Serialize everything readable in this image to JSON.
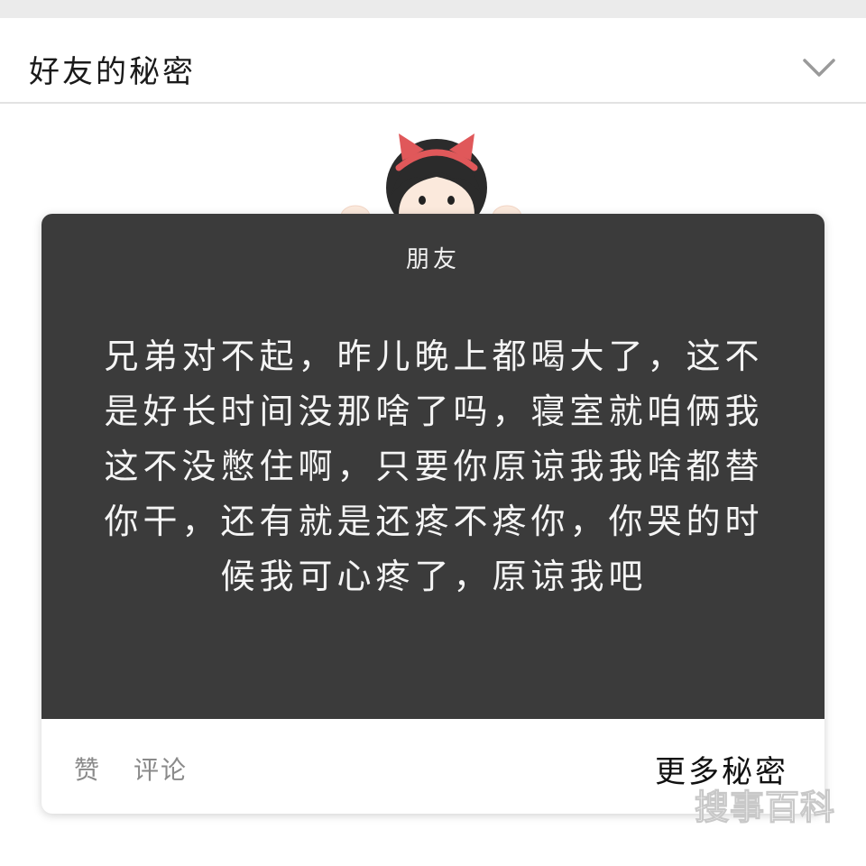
{
  "header": {
    "title": "好友的秘密",
    "expand_icon": "chevron-down-icon"
  },
  "card": {
    "label": "朋友",
    "message": "兄弟对不起，昨儿晚上都喝大了，这不是好长时间没那啥了吗，寝室就咱俩我这不没憋住啊，只要你原谅我我啥都替你干，还有就是还疼不疼你，你哭的时候我可心疼了，原谅我吧",
    "mascot": "girl-peeking-illustration",
    "background_color": "#3b3b3b"
  },
  "actions": {
    "like": "赞",
    "comment": "评论",
    "more": "更多秘密"
  },
  "watermark": {
    "text": "搜事百科"
  }
}
